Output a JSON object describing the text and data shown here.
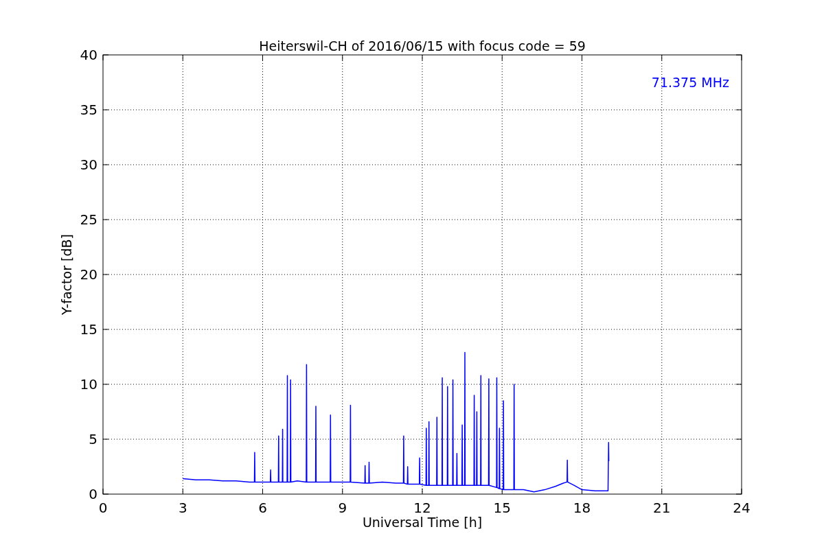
{
  "chart_data": {
    "type": "line",
    "title": "Heiterswil-CH of 2016/06/15 with focus code = 59",
    "xlabel": "Universal Time [h]",
    "ylabel": "Y-factor [dB]",
    "x": [
      3,
      3.5,
      4,
      4.5,
      5,
      5.5,
      5.69,
      5.7,
      5.71,
      6,
      6.29,
      6.3,
      6.31,
      6.59,
      6.6,
      6.61,
      6.74,
      6.75,
      6.76,
      6.92,
      6.93,
      6.94,
      7.04,
      7.05,
      7.06,
      7.3,
      7.64,
      7.65,
      7.66,
      7.99,
      8.0,
      8.01,
      8.54,
      8.55,
      8.56,
      9.29,
      9.3,
      9.31,
      9.84,
      9.85,
      9.86,
      9.99,
      10.0,
      10.01,
      10.5,
      11,
      11.29,
      11.3,
      11.31,
      11.44,
      11.45,
      11.46,
      11.89,
      11.9,
      11.91,
      12.14,
      12.15,
      12.16,
      12.24,
      12.25,
      12.26,
      12.54,
      12.55,
      12.56,
      12.74,
      12.75,
      12.76,
      12.94,
      12.95,
      12.96,
      13.14,
      13.15,
      13.16,
      13.29,
      13.3,
      13.31,
      13.49,
      13.5,
      13.51,
      13.59,
      13.6,
      13.61,
      13.94,
      13.95,
      13.96,
      14.04,
      14.05,
      14.06,
      14.19,
      14.2,
      14.21,
      14.49,
      14.5,
      14.51,
      14.79,
      14.8,
      14.81,
      14.89,
      14.9,
      14.91,
      15.04,
      15.05,
      15.06,
      15.44,
      15.45,
      15.46,
      15.8,
      16.2,
      16.6,
      17,
      17.3,
      17.44,
      17.45,
      17.46,
      17.7,
      18,
      18.5,
      18.98,
      19.0,
      19.01
    ],
    "series": [
      {
        "name": "71.375 MHz",
        "color": "#0000ff",
        "values": [
          1.4,
          1.3,
          1.3,
          1.2,
          1.2,
          1.1,
          1.1,
          3.8,
          1.1,
          1.1,
          1.1,
          2.2,
          1.1,
          1.1,
          5.3,
          1.1,
          1.1,
          5.9,
          1.1,
          1.1,
          10.8,
          1.1,
          1.1,
          10.4,
          1.1,
          1.2,
          1.1,
          11.8,
          1.1,
          1.1,
          8.0,
          1.1,
          1.1,
          7.2,
          1.1,
          1.1,
          8.1,
          1.1,
          1.0,
          2.6,
          1.0,
          1.0,
          2.9,
          1.0,
          1.1,
          1.0,
          1.0,
          5.3,
          1.0,
          0.9,
          2.5,
          0.9,
          0.9,
          3.3,
          0.9,
          0.8,
          6.0,
          0.8,
          0.8,
          6.6,
          0.8,
          0.8,
          7.0,
          0.8,
          0.8,
          10.6,
          0.8,
          0.8,
          9.8,
          0.8,
          0.8,
          10.4,
          0.8,
          0.8,
          3.7,
          0.8,
          0.8,
          6.3,
          0.8,
          0.8,
          12.9,
          0.8,
          0.8,
          9.0,
          0.8,
          0.8,
          7.5,
          0.8,
          0.8,
          10.8,
          0.8,
          0.8,
          10.5,
          0.8,
          0.6,
          10.6,
          0.6,
          0.5,
          6.0,
          0.5,
          0.4,
          8.5,
          0.4,
          0.4,
          10.0,
          0.4,
          0.4,
          0.2,
          0.4,
          0.7,
          1.0,
          1.1,
          3.1,
          1.1,
          0.8,
          0.4,
          0.3,
          0.3,
          4.7,
          3.0
        ]
      }
    ],
    "xlim": [
      0,
      24
    ],
    "ylim": [
      0,
      40
    ],
    "xticks": [
      0,
      3,
      6,
      9,
      12,
      15,
      18,
      21,
      24
    ],
    "yticks": [
      0,
      5,
      10,
      15,
      20,
      25,
      30,
      35,
      40
    ],
    "grid": true
  }
}
